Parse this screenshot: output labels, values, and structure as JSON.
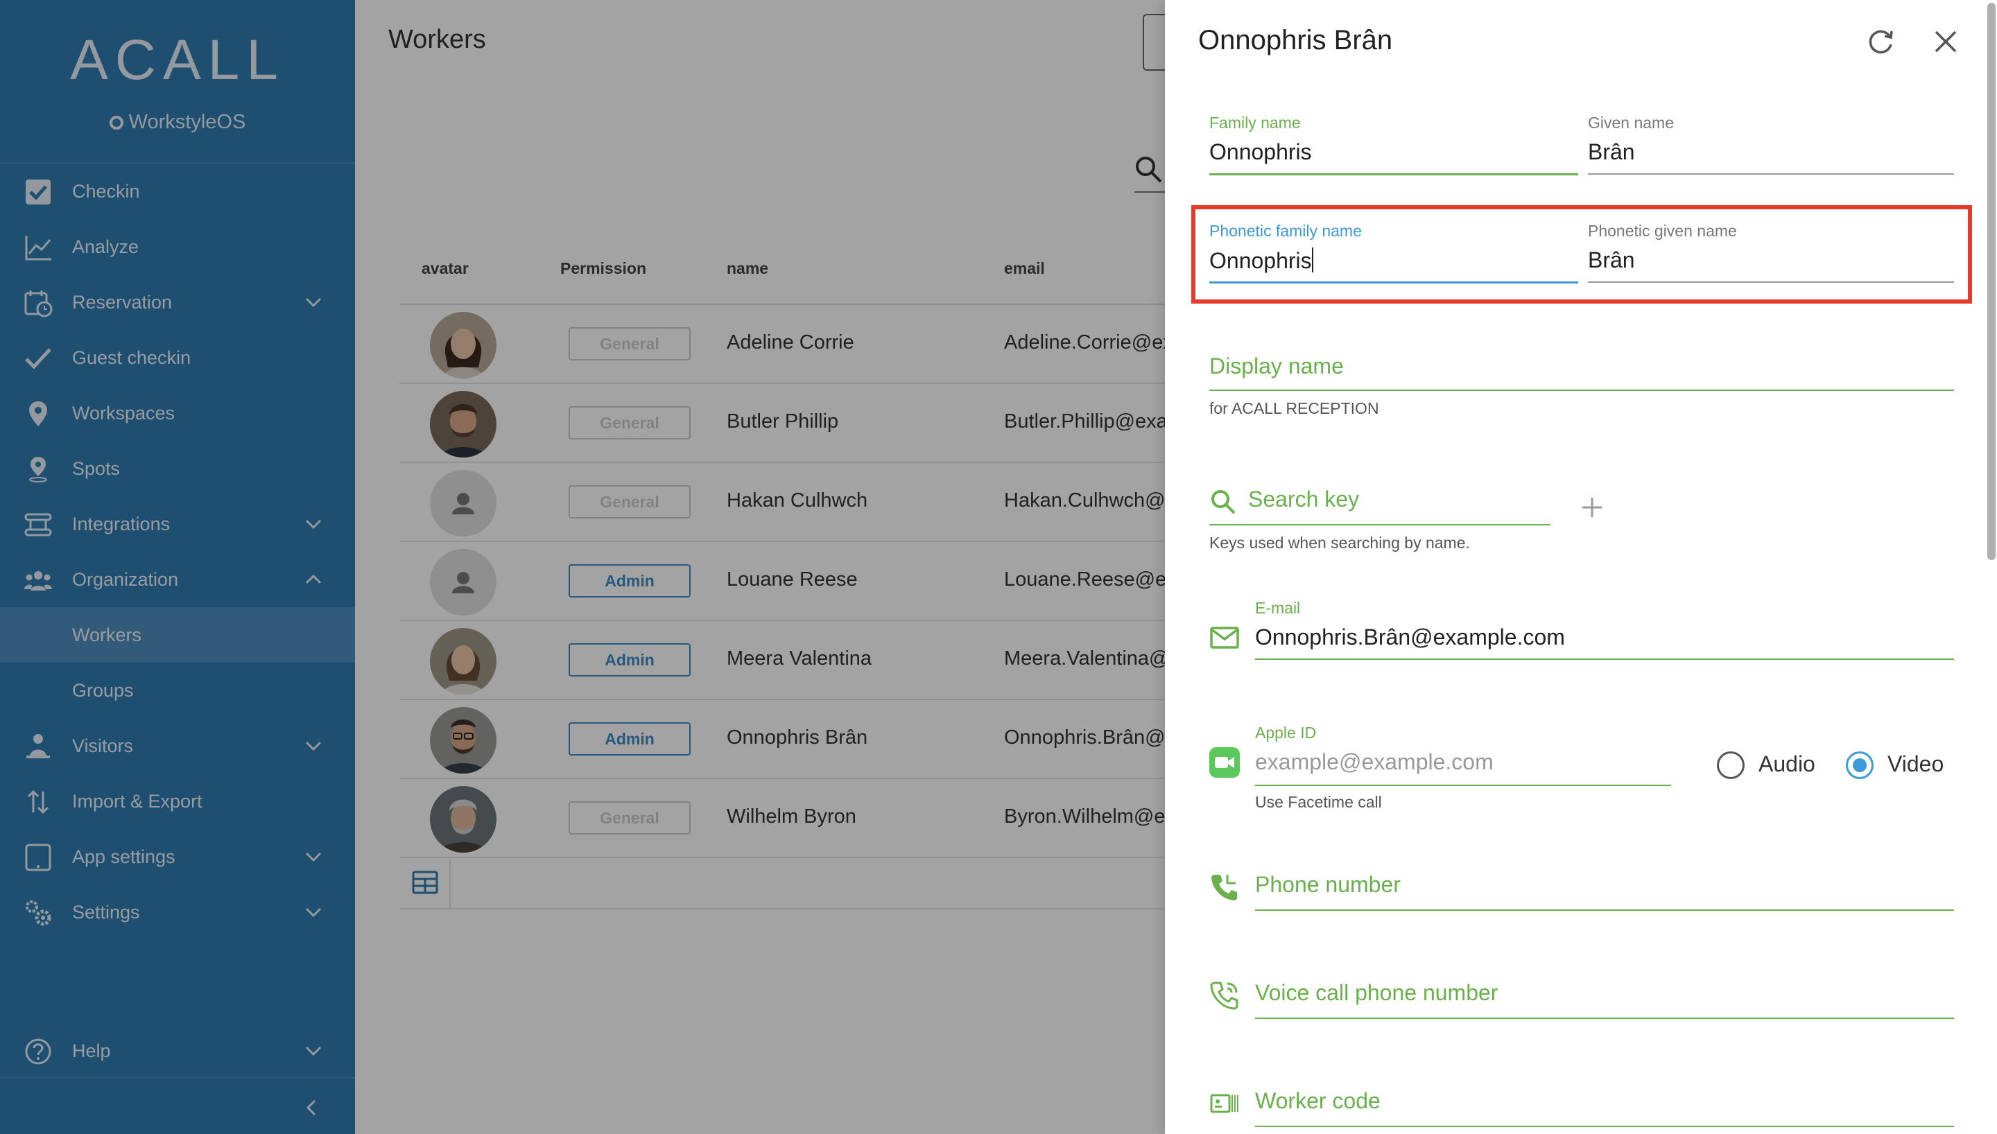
{
  "sidebar": {
    "logo": "ACALL",
    "sublogo": "WorkstyleOS",
    "items": [
      {
        "label": "Checkin",
        "icon": "checkbox-icon",
        "expandable": false
      },
      {
        "label": "Analyze",
        "icon": "line-chart-icon",
        "expandable": false
      },
      {
        "label": "Reservation",
        "icon": "calendar-clock-icon",
        "expandable": true
      },
      {
        "label": "Guest checkin",
        "icon": "checkmark-icon",
        "expandable": false
      },
      {
        "label": "Workspaces",
        "icon": "location-pin-icon",
        "expandable": false
      },
      {
        "label": "Spots",
        "icon": "spot-pin-icon",
        "expandable": false
      },
      {
        "label": "Integrations",
        "icon": "integrations-icon",
        "expandable": true
      },
      {
        "label": "Organization",
        "icon": "people-icon",
        "expandable": true,
        "expanded": true
      },
      {
        "label": "Workers",
        "sub": true,
        "active": true
      },
      {
        "label": "Groups",
        "sub": true
      },
      {
        "label": "Visitors",
        "icon": "visitor-icon",
        "expandable": true
      },
      {
        "label": "Import & Export",
        "icon": "import-export-icon",
        "expandable": false
      },
      {
        "label": "App settings",
        "icon": "tablet-icon",
        "expandable": true
      },
      {
        "label": "Settings",
        "icon": "gears-icon",
        "expandable": true
      }
    ],
    "help": "Help"
  },
  "main": {
    "title": "Workers",
    "columns": [
      "avatar",
      "Permission",
      "name",
      "email"
    ],
    "rows": [
      {
        "permission": "General",
        "name": "Adeline Corrie",
        "email": "Adeline.Corrie@ex"
      },
      {
        "permission": "General",
        "name": "Butler Phillip",
        "email": "Butler.Phillip@exar"
      },
      {
        "permission": "General",
        "name": "Hakan Culhwch",
        "email": "Hakan.Culhwch@e"
      },
      {
        "permission": "Admin",
        "name": "Louane Reese",
        "email": "Louane.Reese@ex"
      },
      {
        "permission": "Admin",
        "name": "Meera Valentina",
        "email": "Meera.Valentina@e"
      },
      {
        "permission": "Admin",
        "name": "Onnophris Brân",
        "email": "Onnophris.Brân@e"
      },
      {
        "permission": "General",
        "name": "Wilhelm Byron",
        "email": "Byron.Wilhelm@ex"
      }
    ]
  },
  "panel": {
    "title": "Onnophris Brân",
    "family_name": {
      "label": "Family name",
      "value": "Onnophris"
    },
    "given_name": {
      "label": "Given name",
      "value": "Brân"
    },
    "phonetic_family_name": {
      "label": "Phonetic family name",
      "value": "Onnophris"
    },
    "phonetic_given_name": {
      "label": "Phonetic given name",
      "value": "Brân"
    },
    "display_name": {
      "placeholder": "Display name",
      "help": "for ACALL RECEPTION"
    },
    "search_key": {
      "placeholder": "Search key",
      "help": "Keys used when searching by name."
    },
    "email": {
      "label": "E-mail",
      "value": "Onnophris.Brân@example.com"
    },
    "apple_id": {
      "label": "Apple ID",
      "placeholder": "example@example.com",
      "help": "Use Facetime call"
    },
    "call_mode": {
      "options": [
        "Audio",
        "Video"
      ],
      "selected": "Video"
    },
    "phone_number": {
      "placeholder": "Phone number"
    },
    "voice_call": {
      "placeholder": "Voice call phone number"
    },
    "worker_code": {
      "placeholder": "Worker code"
    }
  },
  "colors": {
    "sidebar": "#2f7bb0",
    "accent_green": "#6ab04c",
    "accent_blue": "#3d9ad8",
    "highlight_red": "#e53b2c"
  }
}
